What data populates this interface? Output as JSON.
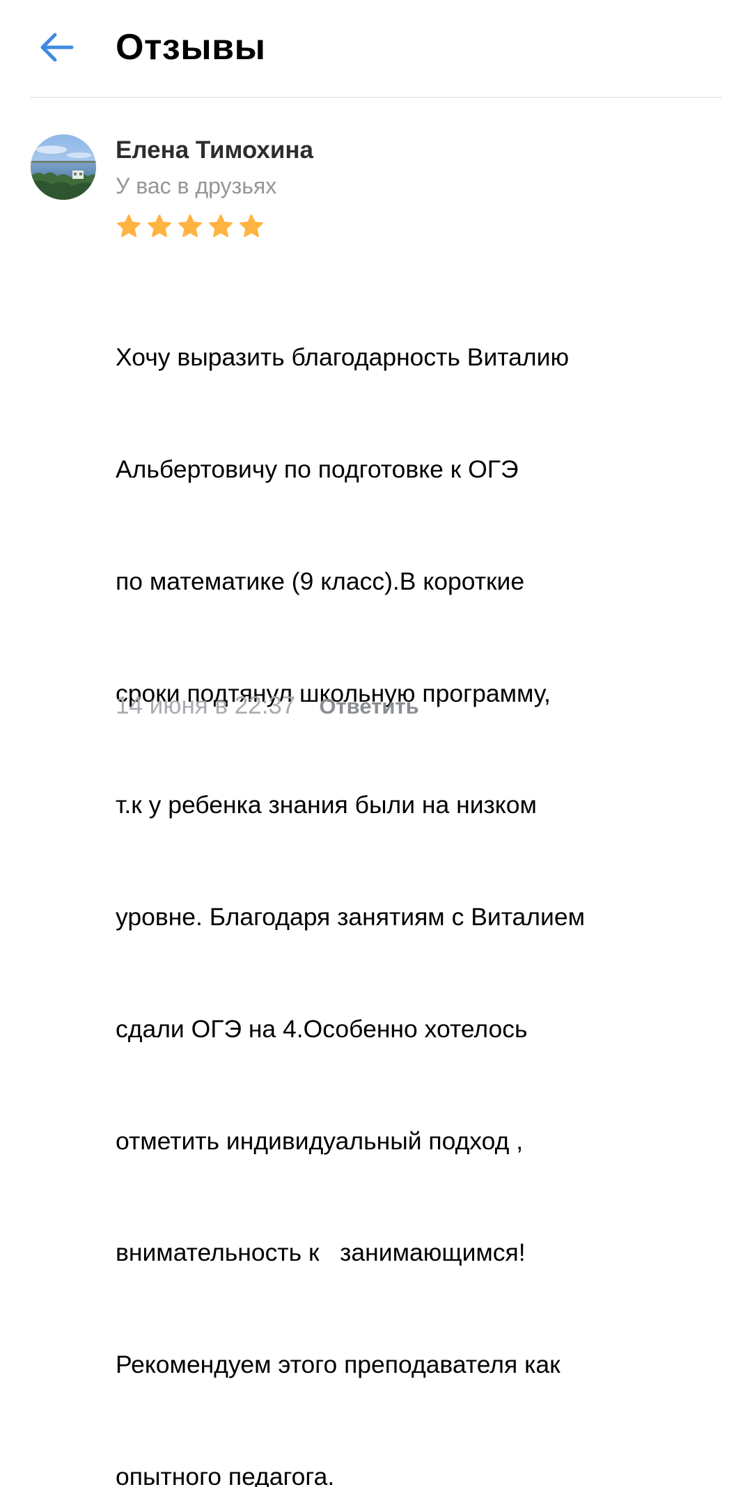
{
  "header": {
    "back_icon": "arrow-left-icon",
    "title": "Отзывы"
  },
  "colors": {
    "accent": "#3f8ae0",
    "star": "#ffb340",
    "divider": "#e7e8ec",
    "secondary_text": "#939699"
  },
  "review": {
    "author": {
      "name": "Елена Тимохина",
      "status": "У вас в друзьях"
    },
    "rating": 5,
    "text_lines": [
      "Хочу выразить благодарность Виталию",
      "Альбертовичу по подготовке к ОГЭ",
      "по математике (9 класс).В короткие",
      "сроки подтянул школьную программу,",
      "т.к у ребенка знания были на низком",
      "уровне. Благодаря занятиям с Виталием",
      "сдали ОГЭ на 4.Особенно хотелось",
      "отметить индивидуальный подход ,",
      "внимательность к   занимающимся!",
      "Рекомендуем этого преподавателя как",
      "опытного педагога."
    ],
    "date": "14 июня в 22:37",
    "reply_label": "Ответить"
  }
}
